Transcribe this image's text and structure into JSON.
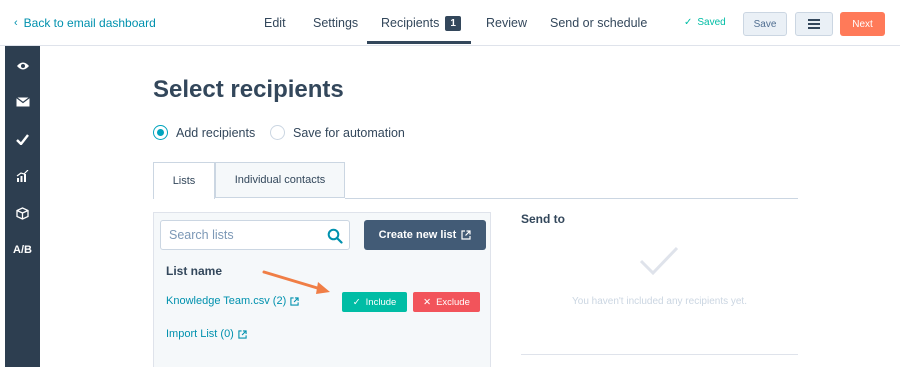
{
  "header": {
    "back_label": "Back to email dashboard",
    "tabs": [
      {
        "label": "Edit"
      },
      {
        "label": "Settings"
      },
      {
        "label": "Recipients",
        "badge": "1"
      },
      {
        "label": "Review"
      },
      {
        "label": "Send or schedule"
      }
    ],
    "active_tab": "Recipients",
    "saved_label": "Saved",
    "save_label": "Save",
    "next_label": "Next"
  },
  "sidebar": {
    "items": [
      {
        "icon": "eye-icon"
      },
      {
        "icon": "envelope-icon"
      },
      {
        "icon": "checkmark-icon"
      },
      {
        "icon": "chart-icon"
      },
      {
        "icon": "box-icon"
      },
      {
        "label": "A/B"
      }
    ]
  },
  "main": {
    "title": "Select recipients",
    "radio_options": [
      {
        "label": "Add recipients",
        "selected": true
      },
      {
        "label": "Save for automation",
        "selected": false
      }
    ],
    "tabs": [
      {
        "label": "Lists",
        "active": true
      },
      {
        "label": "Individual contacts",
        "active": false
      }
    ],
    "search": {
      "placeholder": "Search lists",
      "value": ""
    },
    "create_button": "Create new list",
    "list_header": "List name",
    "lists": [
      {
        "name": "Knowledge Team.csv (2)"
      },
      {
        "name": "Import List (0)"
      }
    ],
    "include_label": "Include",
    "exclude_label": "Exclude",
    "send_to": {
      "title": "Send to",
      "empty_message": "You haven't included any recipients yet."
    }
  },
  "colors": {
    "accent_teal": "#00a4bd",
    "link": "#0091ae",
    "next_orange": "#ff7a59",
    "include_green": "#00bda5",
    "exclude_red": "#f2545b",
    "sidebar_dark": "#2d3e50",
    "annotation_arrow": "#f07e46"
  }
}
